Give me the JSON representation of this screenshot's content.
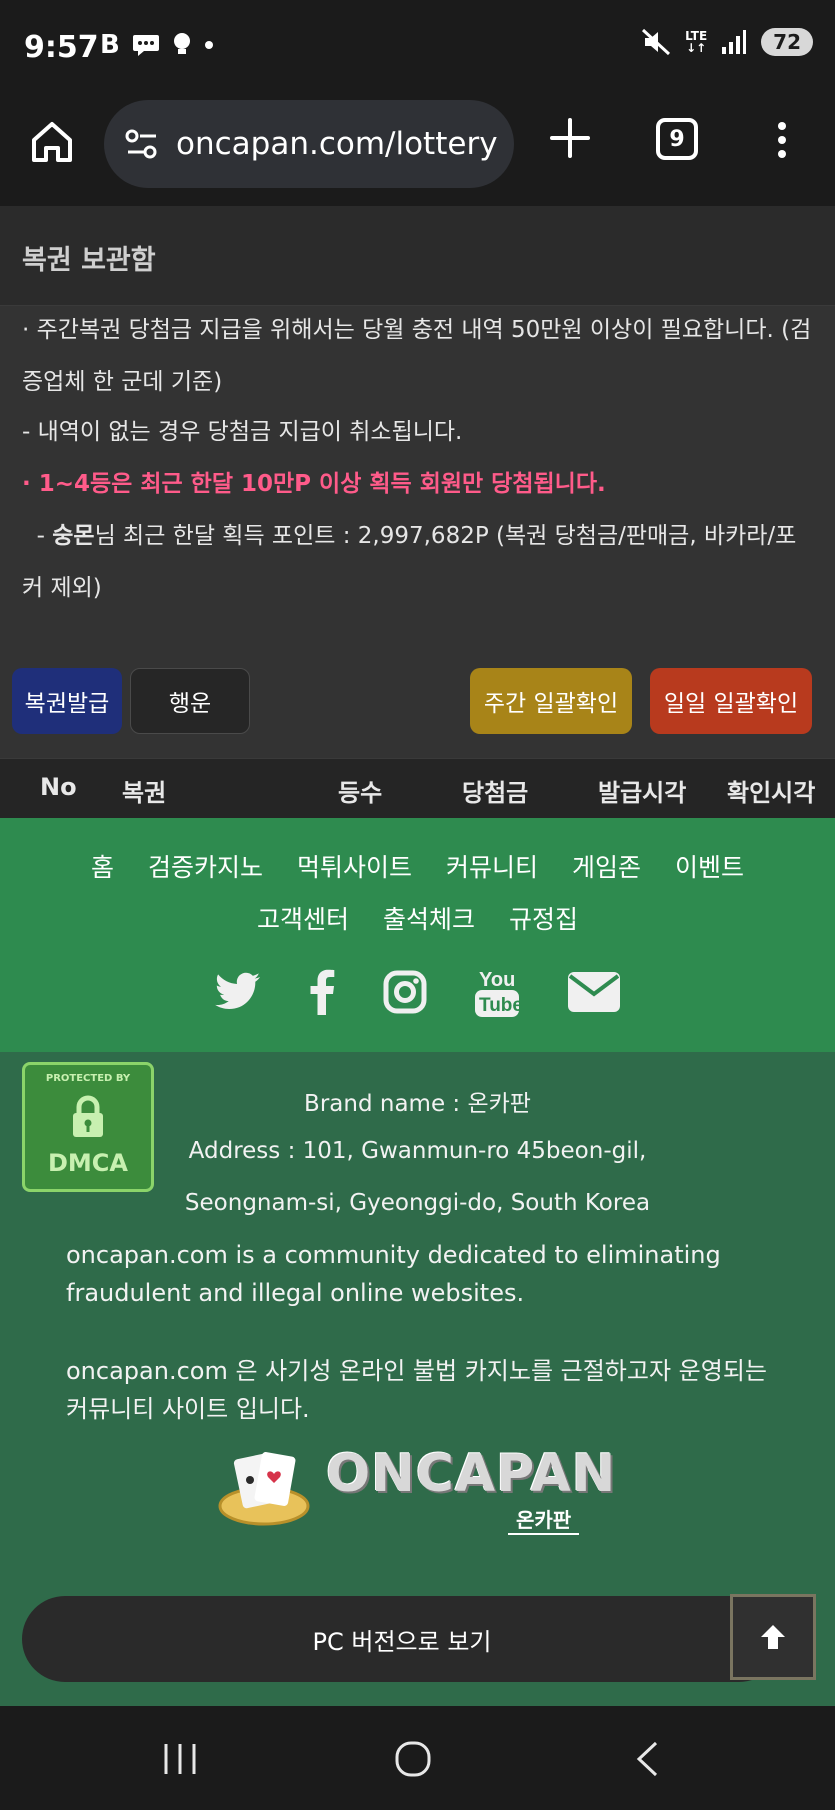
{
  "status": {
    "time": "9:57",
    "battery": "72",
    "network": "LTE"
  },
  "browser": {
    "url": "oncapan.com/lottery",
    "tab_count": "9"
  },
  "page": {
    "title": "복권 보관함",
    "notices": [
      " · 주간복권 당첨금 지급을 위해서는 당월 충전 내역 50만원 이상이 필요합니다. (검증업체 한 군데 기준)",
      "  - 내역이 없는 경우 당첨금 지급이 취소됩니다.",
      " · 1~4등은 최근 한달 10만P 이상 획득 회원만 당첨됩니다.",
      "숭몬",
      "님 최근 한달 획득 포인트 : 2,997,682P (복권 당첨금/판매금, 바카라/포커 제외)"
    ],
    "notice4_prefix": "  - ",
    "buttons": {
      "issue": "복권발급",
      "luck": "행운",
      "weekly_confirm": "주간 일괄확인",
      "daily_confirm": "일일 일괄확인"
    },
    "table_headers": [
      "No",
      "복권",
      "등수",
      "당첨금",
      "발급시각",
      "확인시각"
    ]
  },
  "footer": {
    "nav_row1": [
      "홈",
      "검증카지노",
      "먹튀사이트",
      "커뮤니티",
      "게임존",
      "이벤트"
    ],
    "nav_row2": [
      "고객센터",
      "출석체크",
      "규정집"
    ],
    "social_icons": [
      "twitter-icon",
      "facebook-icon",
      "instagram-icon",
      "youtube-icon",
      "email-icon"
    ],
    "dmca_top": "PROTECTED BY",
    "dmca_bottom": "DMCA",
    "brand_line": "Brand name : 온카판",
    "address_line1": "Address : 101, Gwanmun-ro 45beon-gil,",
    "address_line2": "Seongnam-si, Gyeonggi-do, South Korea",
    "desc_en": "oncapan.com is a community dedicated to eliminating fraudulent and illegal online websites.",
    "desc_ko": "oncapan.com 은 사기성 온라인 불법 카지노를 근절하고자 운영되는 커뮤니티 사이트 입니다.",
    "logo_text": "ONCAPAN",
    "logo_sub": "온카판",
    "pc_button": "PC 버전으로 보기"
  },
  "colors": {
    "issue_btn": "#1f2f7a",
    "weekly_btn": "#a88418",
    "daily_btn": "#b83a1e",
    "highlight_text": "#ff5b8a",
    "footer_nav_bg": "#2e8b4f",
    "footer_info_bg": "#2f6b4a"
  }
}
